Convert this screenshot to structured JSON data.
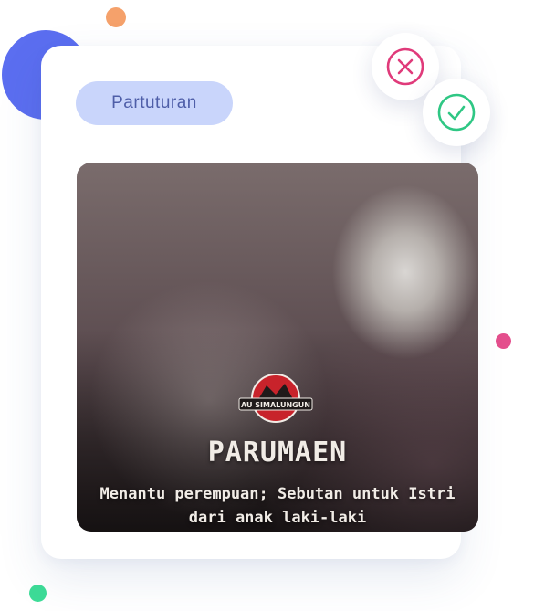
{
  "card": {
    "tag_label": "Partuturan",
    "actions": {
      "reject_icon": "close-circle-icon",
      "accept_icon": "check-circle-icon",
      "reject_color": "#e03a7a",
      "accept_color": "#2fc784"
    },
    "image": {
      "logo_text": "AU SIMALUNGUN",
      "title": "PARUMAEN",
      "caption": "Menantu perempuan; Sebutan untuk Istri dari anak laki-laki"
    }
  },
  "colors": {
    "tag_bg": "#c9d5fb",
    "tag_text": "#4e5ea8",
    "dot_orange": "#f5a16b",
    "dot_pink": "#e44f8d",
    "dot_green": "#3ddc97",
    "blob_blue": "#5b6ef0"
  }
}
